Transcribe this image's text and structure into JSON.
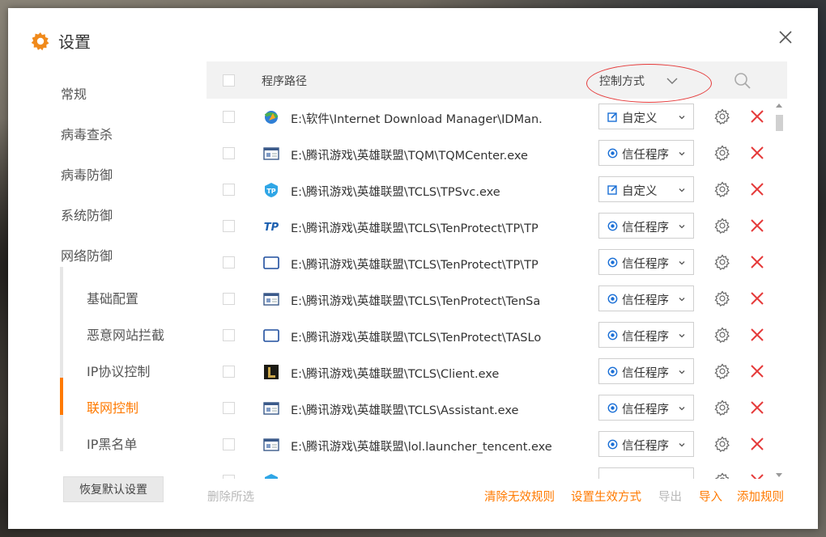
{
  "window": {
    "title": "设置"
  },
  "sidebar": {
    "items": [
      {
        "label": "常规"
      },
      {
        "label": "病毒查杀"
      },
      {
        "label": "病毒防御"
      },
      {
        "label": "系统防御"
      },
      {
        "label": "网络防御"
      }
    ],
    "sub_items": [
      {
        "label": "基础配置",
        "active": false
      },
      {
        "label": "恶意网站拦截",
        "active": false
      },
      {
        "label": "IP协议控制",
        "active": false
      },
      {
        "label": "联网控制",
        "active": true
      },
      {
        "label": "IP黑名单",
        "active": false
      }
    ],
    "restore_label": "恢复默认设置"
  },
  "table": {
    "col_path": "程序路径",
    "col_mode": "控制方式",
    "rows": [
      {
        "path": "E:\\软件\\Internet Download Manager\\IDMan.",
        "mode": "自定义",
        "icon": "idm-globe-icon"
      },
      {
        "path": "E:\\腾讯游戏\\英雄联盟\\TQM\\TQMCenter.exe",
        "mode": "信任程序",
        "icon": "window-app-icon"
      },
      {
        "path": "E:\\腾讯游戏\\英雄联盟\\TCLS\\TPSvc.exe",
        "mode": "自定义",
        "icon": "tp-badge-icon"
      },
      {
        "path": "E:\\腾讯游戏\\英雄联盟\\TCLS\\TenProtect\\TP\\TP",
        "mode": "信任程序",
        "icon": "tp-logo-icon"
      },
      {
        "path": "E:\\腾讯游戏\\英雄联盟\\TCLS\\TenProtect\\TP\\TP",
        "mode": "信任程序",
        "icon": "blank-window-icon"
      },
      {
        "path": "E:\\腾讯游戏\\英雄联盟\\TCLS\\TenProtect\\TenSa",
        "mode": "信任程序",
        "icon": "window-app-icon"
      },
      {
        "path": "E:\\腾讯游戏\\英雄联盟\\TCLS\\TenProtect\\TASLo",
        "mode": "信任程序",
        "icon": "blank-window-icon"
      },
      {
        "path": "E:\\腾讯游戏\\英雄联盟\\TCLS\\Client.exe",
        "mode": "信任程序",
        "icon": "lol-l-icon"
      },
      {
        "path": "E:\\腾讯游戏\\英雄联盟\\TCLS\\Assistant.exe",
        "mode": "信任程序",
        "icon": "window-app-icon"
      },
      {
        "path": "E:\\腾讯游戏\\英雄联盟\\lol.launcher_tencent.exe",
        "mode": "信任程序",
        "icon": "window-app-icon"
      },
      {
        "path": "",
        "mode": "",
        "icon": "tp-badge-icon"
      }
    ]
  },
  "footer": {
    "delete_selected": "删除所选",
    "clear_invalid": "清除无效规则",
    "set_effective": "设置生效方式",
    "export": "导出",
    "import": "导入",
    "add_rule": "添加规则"
  },
  "colors": {
    "accent": "#ff7a00",
    "danger": "#e53a3a",
    "annotation": "#e53a3a"
  }
}
